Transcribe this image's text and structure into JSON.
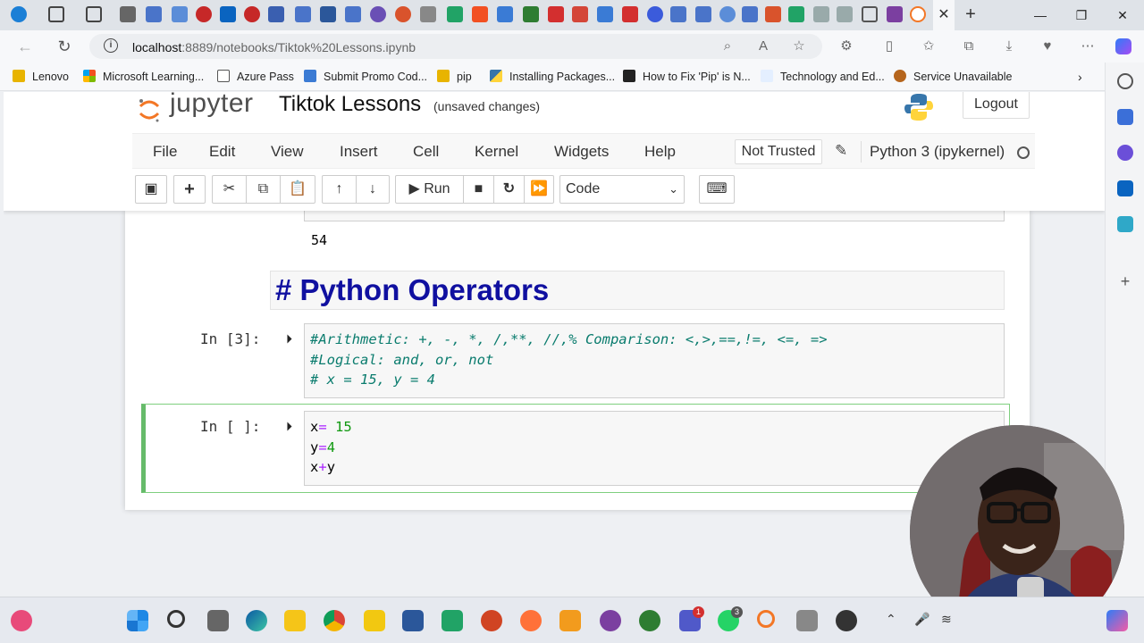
{
  "browser": {
    "url_host": "localhost",
    "url_rest": ":8889/notebooks/Tiktok%20Lessons.ipynb",
    "bookmarks": [
      "Lenovo",
      "Microsoft Learning...",
      "Azure Pass",
      "Submit Promo Cod...",
      "pip",
      "Installing Packages...",
      "How to Fix 'Pip' is N...",
      "Technology and Ed...",
      "Service Unavailable"
    ],
    "bookmark_colors": [
      "#e8b400",
      "#f25022",
      "#555555",
      "#3b7bd4",
      "#e8b400",
      "#3775a9",
      "#222222",
      "#e4efff",
      "#b5651d"
    ]
  },
  "jupyter": {
    "logo_text": "jupyter",
    "notebook_title": "Tiktok Lessons",
    "status": "(unsaved changes)",
    "logout_label": "Logout",
    "menu": [
      "File",
      "Edit",
      "View",
      "Insert",
      "Cell",
      "Kernel",
      "Widgets",
      "Help"
    ],
    "trust_label": "Not Trusted",
    "kernel_name": "Python 3 (ipykernel)",
    "run_label": "Run",
    "cell_type": "Code"
  },
  "notebook": {
    "prev_output": "54",
    "markdown_heading": "# Python Operators",
    "cell3_prompt": "In [3]:",
    "cell3_lines": [
      "#Arithmetic: +, -, *, /,**, //,% Comparison: <,>,==,!=, <=, =>",
      "#Logical: and, or, not",
      "# x = 15, y = 4"
    ],
    "cell4_prompt": "In [ ]:",
    "cell4_line1_var": "x",
    "cell4_line1_op": "=",
    "cell4_line1_num": " 15",
    "cell4_line2_var": "y",
    "cell4_line2_op": "=",
    "cell4_line2_num": "4",
    "cell4_line3_a": "x",
    "cell4_line3_op": "+",
    "cell4_line3_b": "y"
  },
  "taskbar": {
    "badges": [
      "1",
      "3"
    ]
  },
  "colors": {
    "heading": "#1010a0",
    "comment": "#0a7c6e",
    "selected_cell_border": "#66bb6a"
  }
}
